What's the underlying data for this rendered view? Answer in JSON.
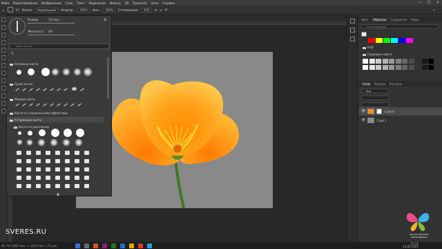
{
  "menubar": {
    "items": [
      "Файл",
      "Редактирование",
      "Изображение",
      "Слои",
      "Текст",
      "Выделение",
      "Фильтр",
      "3D",
      "Просмотр",
      "Окно",
      "Справка"
    ],
    "window_controls": [
      "—",
      "❐",
      "✕"
    ]
  },
  "options": {
    "size_value": "13",
    "mode_label": "Режим:",
    "mode_value": "Нормальный",
    "opacity_label": "Непрозр.:",
    "opacity_value": "100%",
    "flow_label": "Наж.:",
    "flow_value": "100%",
    "smoothing_label": "Сглаживание:",
    "smoothing_value": "10%",
    "angle_value": "0°"
  },
  "brush_panel": {
    "size_label": "Размер:",
    "size_value": "13 пикс.",
    "hardness_label": "Жесткость:",
    "hardness_value": "0%",
    "search_placeholder": "Поиск кистей",
    "groups": [
      "Основные кисти",
      "Сухие кисти",
      "Мокрые кисти",
      "Кисти со специальными эффектами",
      "Устаревшие кисти",
      "Кисти по умолчанию"
    ]
  },
  "document": {
    "status": "45.7%  1280 пикс. x 1024 пикс. (72 ppi)"
  },
  "right_panel": {
    "swatch_tabs": [
      "Цвет",
      "Образцы",
      "Градиенты",
      "Узоры"
    ],
    "swatch_search": "Поиск образцов",
    "swatch_groups": [
      "RGB",
      "Градации серого"
    ],
    "layer_tabs": [
      "Слои",
      "Каналы",
      "Контуры"
    ],
    "layer_kind": "Вид",
    "layers": [
      {
        "name": "Слой 0"
      },
      {
        "name": "Слой 1"
      }
    ],
    "swatch_colors": [
      "#ff0000",
      "#ffff00",
      "#00ff00",
      "#00ffff",
      "#0000ff",
      "#ff00ff"
    ],
    "gray_colors": [
      "#ffffff",
      "#e6e6e6",
      "#cccccc",
      "#b3b3b3",
      "#999999",
      "#808080",
      "#666666",
      "#4d4d4d",
      "#333333",
      "#1a1a1a",
      "#000000"
    ]
  },
  "taskbar": {
    "time": "17:11",
    "date": "13.04.2021"
  },
  "watermark": {
    "site": "SVERES.RU",
    "caption_line1": "ШКОЛА ДИЗАЙНА",
    "caption_line2": "СЕРГЕЯ ВЕРЕСА"
  }
}
